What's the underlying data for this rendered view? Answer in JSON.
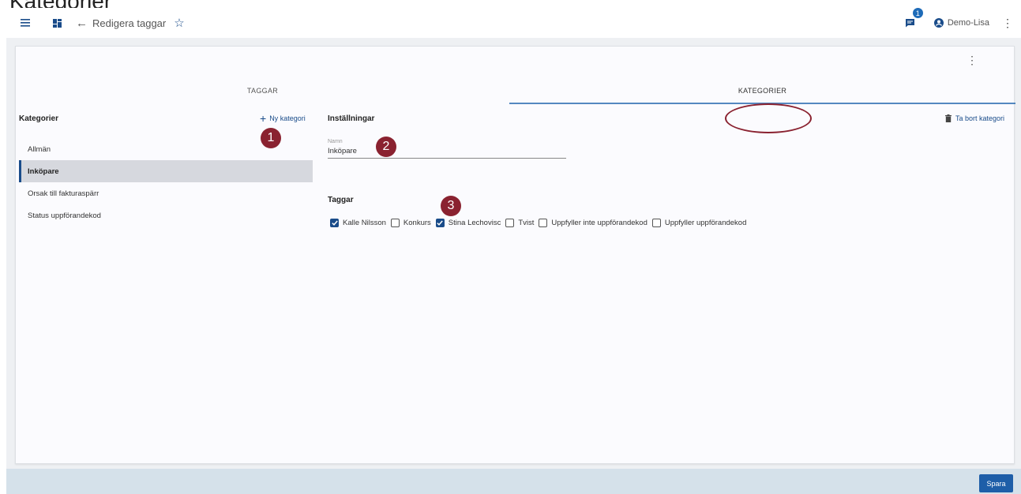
{
  "page_heading": "Kategorier",
  "app_bar": {
    "breadcrumb": "Redigera taggar",
    "notification_count": "1",
    "user_name": "Demo-Lisa"
  },
  "tabs": [
    {
      "label": "TAGGAR",
      "active": false
    },
    {
      "label": "KATEGORIER",
      "active": true
    }
  ],
  "left_panel": {
    "title": "Kategorier",
    "new_category": "Ny kategori",
    "items": [
      {
        "label": "Allmän",
        "active": false
      },
      {
        "label": "Inköpare",
        "active": true
      },
      {
        "label": "Orsak till fakturaspärr",
        "active": false
      },
      {
        "label": "Status uppförandekod",
        "active": false
      }
    ]
  },
  "settings": {
    "title": "Inställningar",
    "delete_category": "Ta bort kategori",
    "name_label": "Namn",
    "name_value": "Inköpare"
  },
  "tags": {
    "title": "Taggar",
    "items": [
      {
        "label": "Kalle Nilsson",
        "checked": true
      },
      {
        "label": "Konkurs",
        "checked": false
      },
      {
        "label": "Stina Lechovisc",
        "checked": true
      },
      {
        "label": "Tvist",
        "checked": false
      },
      {
        "label": "Uppfyller inte uppförandekod",
        "checked": false
      },
      {
        "label": "Uppfyller uppförandekod",
        "checked": false
      }
    ]
  },
  "annotations": [
    "1",
    "2",
    "3"
  ],
  "footer": {
    "save_label": "Spara"
  },
  "colors": {
    "accent": "#1a4c8a",
    "annotation": "#8a2230",
    "footer_bg": "#d5e1ea"
  }
}
